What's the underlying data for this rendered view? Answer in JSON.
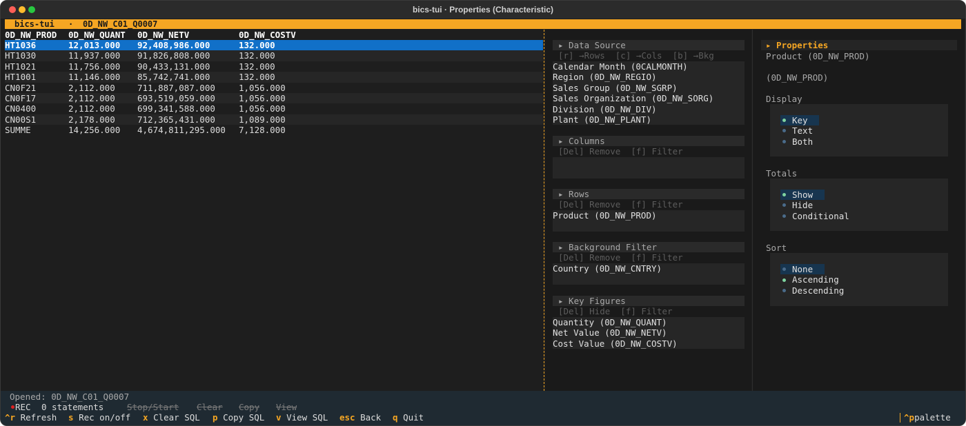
{
  "window": {
    "title": "bics-tui · Properties (Characteristic)"
  },
  "app_bar": {
    "app_name": "bics-tui",
    "separator": "·",
    "query": "0D_NW_C01_Q0007"
  },
  "grid": {
    "columns": [
      "0D_NW_PROD",
      "0D_NW_QUANT",
      "0D_NW_NETV",
      "0D_NW_COSTV"
    ],
    "rows": [
      [
        "HT1036",
        "12,013.000",
        "92,408,986.000",
        "132.000"
      ],
      [
        "HT1030",
        "11,937.000",
        "91,826,808.000",
        "132.000"
      ],
      [
        "HT1021",
        "11,756.000",
        "90,433,131.000",
        "132.000"
      ],
      [
        "HT1001",
        "11,146.000",
        "85,742,741.000",
        "132.000"
      ],
      [
        "CN0F21",
        "2,112.000",
        "711,887,087.000",
        "1,056.000"
      ],
      [
        "CN0F17",
        "2,112.000",
        "693,519,059.000",
        "1,056.000"
      ],
      [
        "CN0400",
        "2,112.000",
        "699,341,588.000",
        "1,056.000"
      ],
      [
        "CN00S1",
        "2,178.000",
        "712,365,431.000",
        "1,089.000"
      ],
      [
        "SUMME",
        "14,256.000",
        "4,674,811,295.000",
        "7,128.000"
      ]
    ]
  },
  "layout_panel": {
    "data_source": {
      "title": "▸ Data Source",
      "hint": "[r] →Rows  [c] →Cols  [b] →Bkg",
      "items": [
        "Calendar Month (0CALMONTH)",
        "Region (0D_NW_REGIO)",
        "Sales Group (0D_NW_SGRP)",
        "Sales Organization (0D_NW_SORG)",
        "Division (0D_NW_DIV)",
        "Plant (0D_NW_PLANT)"
      ]
    },
    "columns": {
      "title": "▸ Columns",
      "hint": "[Del] Remove  [f] Filter",
      "items": []
    },
    "rows": {
      "title": "▸ Rows",
      "hint": "[Del] Remove  [f] Filter",
      "items": [
        "Product (0D_NW_PROD)"
      ]
    },
    "background_filter": {
      "title": "▸ Background Filter",
      "hint": "[Del] Remove  [f] Filter",
      "items": [
        "Country (0D_NW_CNTRY)"
      ]
    },
    "key_figures": {
      "title": "▸ Key Figures",
      "hint": "[Del] Hide  [f] Filter",
      "items": [
        "Quantity (0D_NW_QUANT)",
        "Net Value (0D_NW_NETV)",
        "Cost Value (0D_NW_COSTV)"
      ]
    }
  },
  "properties": {
    "title": "▸ Properties",
    "name": "Product (0D_NW_PROD)",
    "technical_name": "(0D_NW_PROD)",
    "display": {
      "label": "Display",
      "options": [
        "Key",
        "Text",
        "Both"
      ],
      "selected": "Key"
    },
    "totals": {
      "label": "Totals",
      "options": [
        "Show",
        "Hide",
        "Conditional"
      ],
      "selected": "Show"
    },
    "sort": {
      "label": "Sort",
      "options": [
        "None",
        "Ascending",
        "Descending"
      ],
      "selected": "Ascending",
      "highlighted": "None"
    }
  },
  "status": {
    "opened": "Opened: 0D_NW_C01_Q0007",
    "rec_label": "REC",
    "statements": "0 statements",
    "disabled_actions": [
      "Stop/Start",
      "Clear",
      "Copy",
      "View"
    ]
  },
  "keybar": [
    {
      "key": "^r",
      "label": "Refresh"
    },
    {
      "key": "s",
      "label": "Rec on/off"
    },
    {
      "key": "x",
      "label": "Clear SQL"
    },
    {
      "key": "p",
      "label": "Copy SQL"
    },
    {
      "key": "v",
      "label": "View SQL"
    },
    {
      "key": "esc",
      "label": "Back"
    },
    {
      "key": "q",
      "label": "Quit"
    }
  ],
  "palette": {
    "key": "^p",
    "label": "palette"
  },
  "colors": {
    "accent": "#f5a623",
    "selection": "#1170c8",
    "rec": "#e02020",
    "radio_on": "#7fd4a0"
  }
}
